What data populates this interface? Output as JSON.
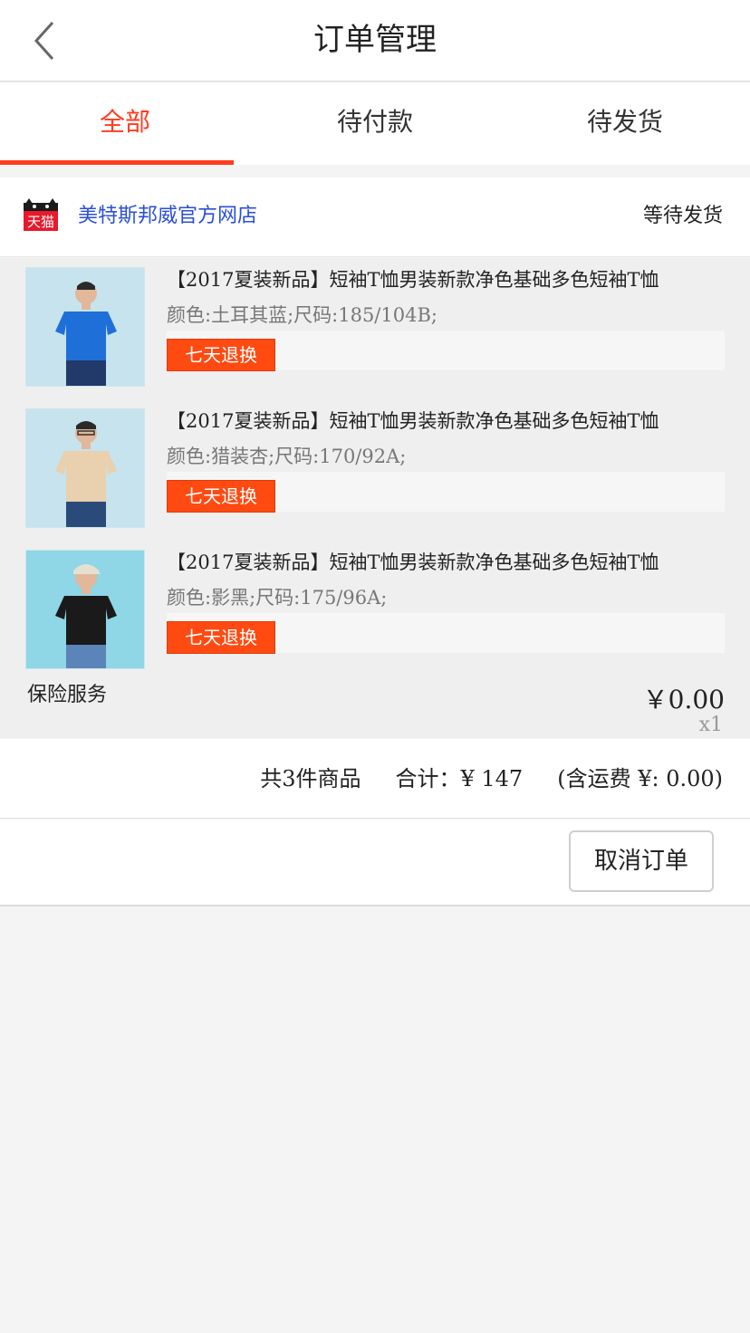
{
  "header": {
    "title": "订单管理"
  },
  "tabs": [
    {
      "label": "全部"
    },
    {
      "label": "待付款"
    },
    {
      "label": "待发货"
    }
  ],
  "shop": {
    "logo_text": "天猫",
    "name": "美特斯邦威官方网店",
    "status": "等待发货"
  },
  "items": [
    {
      "title": "【2017夏装新品】短袖T恤男装新款净色基础多色短袖T恤",
      "spec": "颜色:土耳其蓝;尺码:185/104B;",
      "badge": "七天退换",
      "shirt_color": "#1e6fd8"
    },
    {
      "title": "【2017夏装新品】短袖T恤男装新款净色基础多色短袖T恤",
      "spec": "颜色:猎装杏;尺码:170/92A;",
      "badge": "七天退换",
      "shirt_color": "#e9d0ae"
    },
    {
      "title": "【2017夏装新品】短袖T恤男装新款净色基础多色短袖T恤",
      "spec": "颜色:影黑;尺码:175/96A;",
      "badge": "七天退换",
      "shirt_color": "#1a1a1a"
    }
  ],
  "insurance": {
    "label": "保险服务",
    "price": "￥0.00",
    "qty": "x1"
  },
  "summary": {
    "count": "共3件商品",
    "total": "合计：¥ 147",
    "shipping": "(含运费 ¥: 0.00)"
  },
  "actions": {
    "cancel_label": "取消订单"
  },
  "colors": {
    "accent": "#ff3b1f",
    "badge": "#ff4a12",
    "shop_link": "#2a4fd6"
  }
}
